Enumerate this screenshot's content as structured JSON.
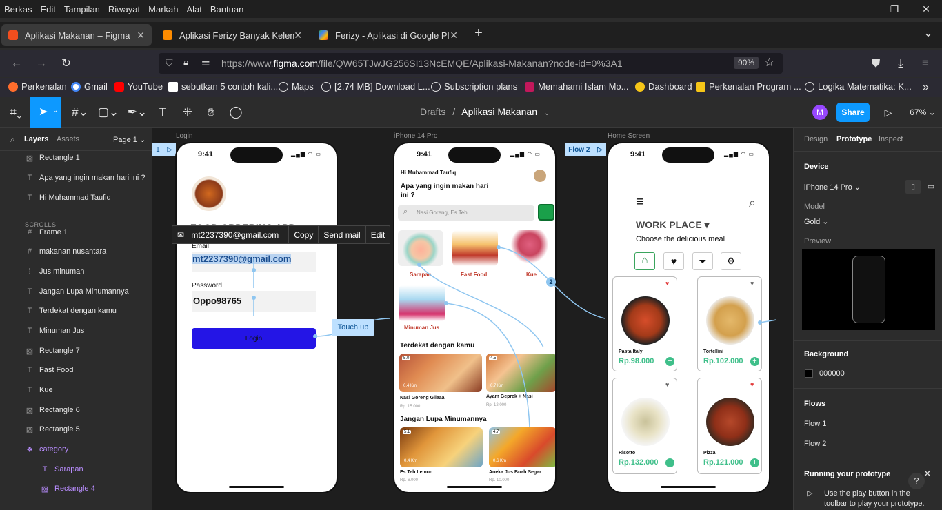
{
  "menubar": {
    "items": [
      "Berkas",
      "Edit",
      "Tampilan",
      "Riwayat",
      "Markah",
      "Alat",
      "Bantuan"
    ]
  },
  "tabs": [
    {
      "label": "Aplikasi Makanan – Figma",
      "color": "#f24e1e"
    },
    {
      "label": "Aplikasi Ferizy Banyak Kelemah",
      "color": "#ff8c00"
    },
    {
      "label": "Ferizy - Aplikasi di Google Play",
      "color": "#34a853"
    }
  ],
  "url": {
    "prefix": "https://www.",
    "host": "figma.com",
    "path": "/file/QW65TJwJG256SI13NcEMQE/Aplikasi-Makanan?node-id=0%3A1",
    "zoom": "90%"
  },
  "bookmarks": [
    "Perkenalan",
    "Gmail",
    "YouTube",
    "sebutkan 5 contoh kali...",
    "Maps",
    "[2.74 MB] Download L...",
    "Subscription plans",
    "Memahami Islam Mo...",
    "Dashboard",
    "Perkenalan Program ...",
    "Logika Matematika: K..."
  ],
  "figma": {
    "crumb_root": "Drafts",
    "crumb_sep": "/",
    "file_name": "Aplikasi Makanan",
    "avatar": "M",
    "share": "Share",
    "zoom": "67%"
  },
  "leftpanel": {
    "tab_layers": "Layers",
    "tab_assets": "Assets",
    "page": "Page 1",
    "section_scrolls": "SCROLLS",
    "layers": [
      {
        "icon": "image",
        "label": "Rectangle 1"
      },
      {
        "icon": "text",
        "label": "Apa yang ingin makan hari ini ?"
      },
      {
        "icon": "text",
        "label": "Hi Muhammad Taufiq"
      },
      {
        "icon": "frame",
        "label": "Frame 1"
      },
      {
        "icon": "frame",
        "label": "makanan nusantara"
      },
      {
        "icon": "group",
        "label": "Jus minuman"
      },
      {
        "icon": "text",
        "label": "Jangan Lupa Minumannya"
      },
      {
        "icon": "text",
        "label": "Terdekat dengan kamu"
      },
      {
        "icon": "text",
        "label": "Minuman Jus"
      },
      {
        "icon": "image",
        "label": "Rectangle 7"
      },
      {
        "icon": "text",
        "label": "Fast Food"
      },
      {
        "icon": "text",
        "label": "Kue"
      },
      {
        "icon": "image",
        "label": "Rectangle 6"
      },
      {
        "icon": "image",
        "label": "Rectangle 5"
      },
      {
        "icon": "component",
        "label": "category"
      },
      {
        "icon": "text",
        "label": "Sarapan"
      },
      {
        "icon": "image",
        "label": "Rectangle 4"
      }
    ]
  },
  "canvas": {
    "frame_labels": [
      "Login",
      "iPhone 14 Pro",
      "Home Screen"
    ],
    "flow1": "1",
    "flow2": "Flow 2",
    "touch_up": "Touch up",
    "badge_2": "2",
    "time": "9:41",
    "login": {
      "title": "FOOD ORDERING APP",
      "email_label": "Email",
      "email_value": "mt2237390@gmail.com",
      "password_label": "Password",
      "password_value": "Oppo98765",
      "button": "Login"
    },
    "context_menu": {
      "email": "mt2237390@gmail.com",
      "copy": "Copy",
      "send": "Send mail",
      "edit": "Edit"
    },
    "home": {
      "greeting": "Hi Muhammad Taufiq",
      "question": "Apa yang ingin makan hari ini ?",
      "search": "Nasi Goreng, Es Teh",
      "categories": [
        "Sarapan",
        "Fast Food",
        "Kue"
      ],
      "juice": "Minuman Jus",
      "near_title": "Terdekat dengan kamu",
      "near": [
        {
          "name": "Nasi Goreng Gilaaa",
          "price": "Rp. 15.000",
          "rating": "5.0",
          "dist": "0.4 Km"
        },
        {
          "name": "Ayam Geprek + Nasi",
          "price": "Rp. 12.000",
          "rating": "4.5",
          "dist": "0.7 Km"
        }
      ],
      "drink_title": "Jangan Lupa Minumannya",
      "drinks": [
        {
          "name": "Es Teh Lemon",
          "price": "Rp. 6.000",
          "rating": "5.1",
          "dist": "0.4 Km"
        },
        {
          "name": "Aneka Jus Buah Segar",
          "price": "Rp. 10.000",
          "rating": "4.7",
          "dist": "0.6 Km"
        }
      ]
    },
    "workplace": {
      "title": "WORK PLACE",
      "subtitle": "Choose the delicious meal",
      "items": [
        {
          "name": "Pasta Italy",
          "price": "Rp.98.000"
        },
        {
          "name": "Tortellini",
          "price": "Rp.102.000"
        },
        {
          "name": "Risotto",
          "price": "Rp.132.000"
        },
        {
          "name": "Pizza",
          "price": "Rp.121.000"
        }
      ]
    }
  },
  "rightpanel": {
    "tabs": [
      "Design",
      "Prototype",
      "Inspect"
    ],
    "device_h": "Device",
    "device": "iPhone 14 Pro",
    "model_h": "Model",
    "model": "Gold",
    "preview_h": "Preview",
    "background_h": "Background",
    "background": "000000",
    "flows_h": "Flows",
    "flows": [
      "Flow 1",
      "Flow 2"
    ],
    "running_h": "Running your prototype",
    "running_text1": "Use the play button in the",
    "running_text2": "toolbar to play your prototype.",
    "help": "?"
  }
}
